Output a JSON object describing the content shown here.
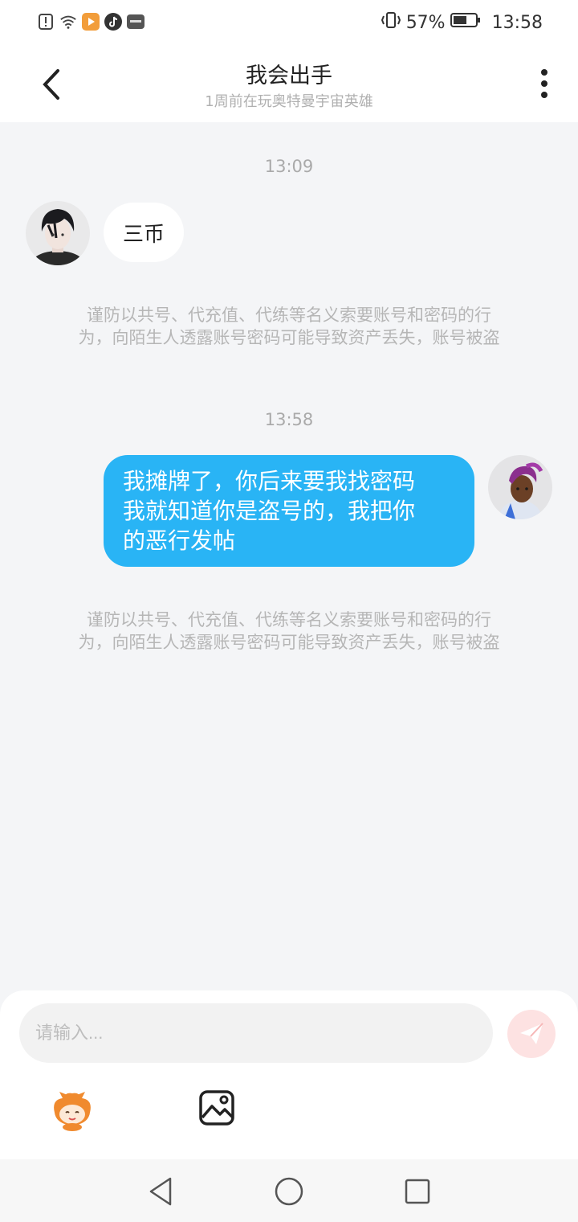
{
  "status_bar": {
    "battery": "57%",
    "time": "13:58",
    "icons": [
      "alert-icon",
      "wifi-icon",
      "media-app-icon",
      "tiktok-icon",
      "huawei-app-icon",
      "vibrate-icon",
      "battery-icon"
    ]
  },
  "header": {
    "title": "我会出手",
    "subtitle": "1周前在玩奥特曼宇宙英雄"
  },
  "messages": [
    {
      "time": "13:09",
      "direction": "incoming",
      "text": "三币"
    },
    {
      "time": "13:58",
      "direction": "outgoing",
      "lines": [
        "我摊牌了，你后来要我找密码",
        "我就知道你是盗号的，我把你",
        "的恶行发帖"
      ]
    }
  ],
  "warning": {
    "line1": "谨防以共号、代充值、代练等名义索要账号和密码的行",
    "line2": "为，向陌生人透露账号密码可能导致资产丢失，账号被盗"
  },
  "input": {
    "placeholder": "请输入..."
  },
  "colors": {
    "outgoing_bubble": "#29b4f5",
    "send_button": "#fde2e2"
  }
}
